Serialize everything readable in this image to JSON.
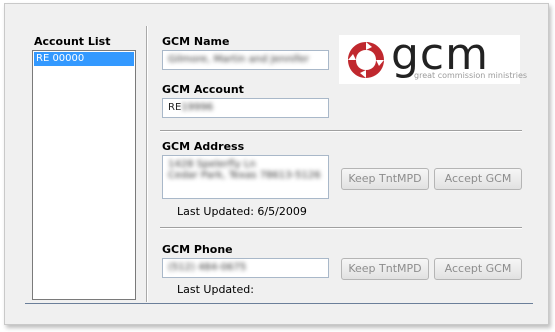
{
  "account_list": {
    "title": "Account List",
    "selected_item": "RE 00000"
  },
  "gcm_name": {
    "label": "GCM Name",
    "value": "Gilmore, Martin and Jennifer"
  },
  "gcm_account": {
    "label": "GCM Account",
    "value_prefix": "RE",
    "value_rest": "19996"
  },
  "logo": {
    "wordmark": "gcm",
    "tagline": "great commission ministries",
    "icon": "gcm-red-swirl-icon",
    "brand_color": "#c0282e"
  },
  "gcm_address": {
    "label": "GCM Address",
    "line1": "1428 Spelerfly Ln",
    "line2": "Cedar Park, Texas 78613-5126",
    "keep_button": "Keep TntMPD",
    "accept_button": "Accept GCM",
    "last_updated": "Last Updated: 6/5/2009"
  },
  "gcm_phone": {
    "label": "GCM Phone",
    "value": "(512) 484-0675",
    "keep_button": "Keep TntMPD",
    "accept_button": "Accept GCM",
    "last_updated": "Last Updated:"
  }
}
